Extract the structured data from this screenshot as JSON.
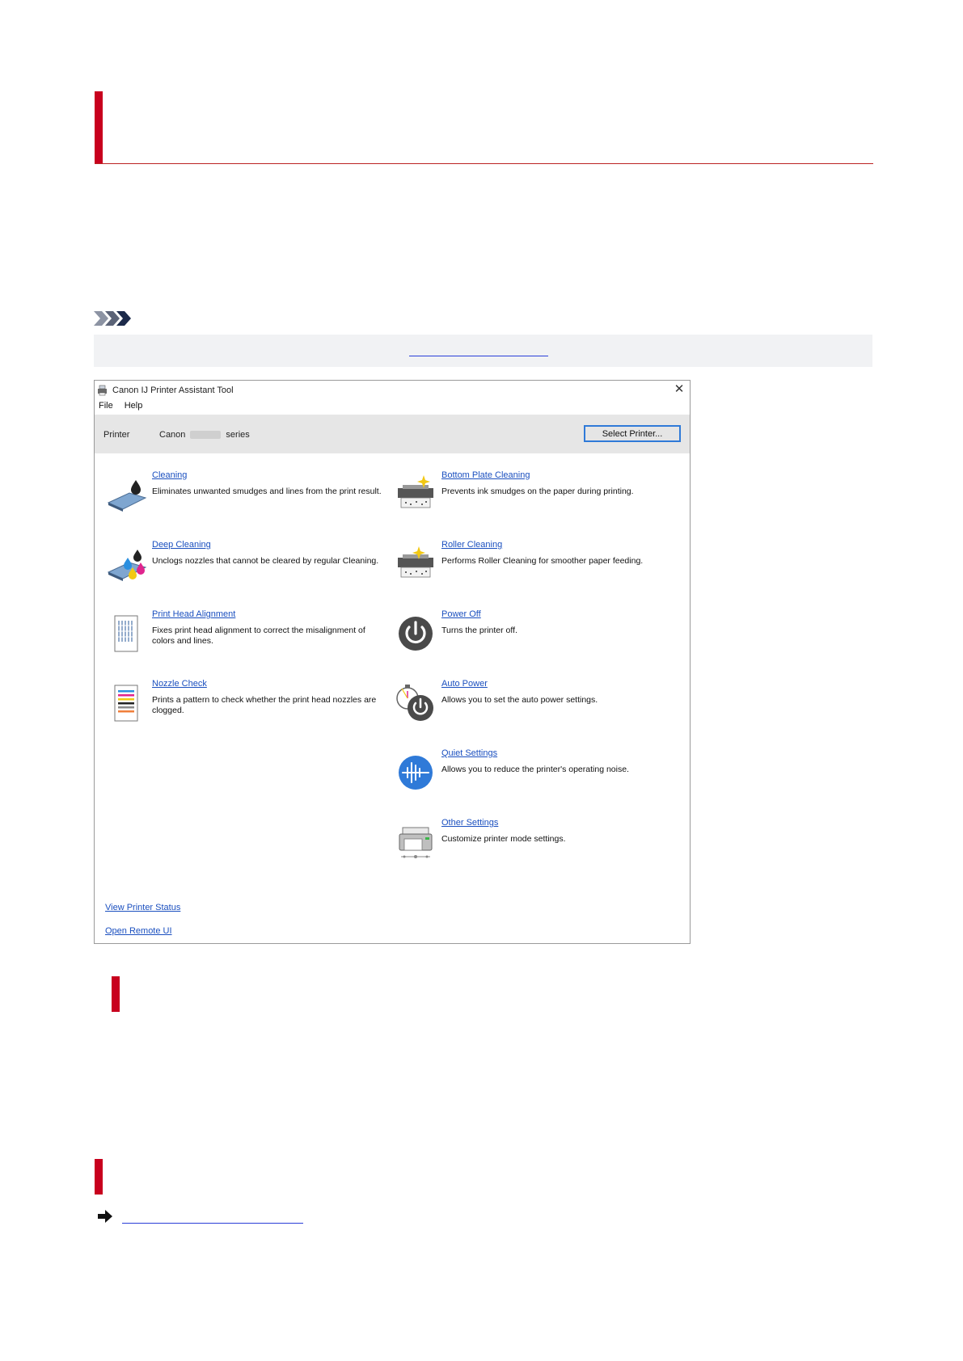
{
  "window": {
    "title": "Canon IJ Printer Assistant Tool",
    "close_glyph": "✕",
    "menu": [
      "File",
      "Help"
    ]
  },
  "printer_bar": {
    "label": "Printer",
    "brand": "Canon",
    "suffix": "series",
    "select_button": "Select Printer..."
  },
  "left_items": [
    {
      "link": "Cleaning",
      "desc": "Eliminates unwanted smudges and lines from the print result.",
      "icon": "cleaning-icon"
    },
    {
      "link": "Deep Cleaning",
      "desc": "Unclogs nozzles that cannot be cleared by regular Cleaning.",
      "icon": "deep-cleaning-icon"
    },
    {
      "link": "Print Head Alignment",
      "desc": "Fixes print head alignment to correct the misalignment of colors and lines.",
      "icon": "print-head-alignment-icon"
    },
    {
      "link": "Nozzle Check",
      "desc": "Prints a pattern to check whether the print head nozzles are clogged.",
      "icon": "nozzle-check-icon"
    }
  ],
  "right_items": [
    {
      "link": "Bottom Plate Cleaning",
      "desc": "Prevents ink smudges on the paper during printing.",
      "icon": "bottom-plate-cleaning-icon"
    },
    {
      "link": "Roller Cleaning",
      "desc": "Performs Roller Cleaning for smoother paper feeding.",
      "icon": "roller-cleaning-icon"
    },
    {
      "link": "Power Off",
      "desc": "Turns the printer off.",
      "icon": "power-icon"
    },
    {
      "link": "Auto Power",
      "desc": "Allows you to set the auto power settings.",
      "icon": "auto-power-icon"
    },
    {
      "link": "Quiet Settings",
      "desc": "Allows you to reduce the printer's operating noise.",
      "icon": "quiet-settings-icon"
    },
    {
      "link": "Other Settings",
      "desc": "Customize printer mode settings.",
      "icon": "printer-settings-icon"
    }
  ],
  "footer": {
    "view_status": "View Printer Status",
    "remote_ui": "Open Remote UI"
  },
  "colors": {
    "accent_red": "#c8001e",
    "link_blue": "#1a4fbf",
    "button_border": "#2f7ad8"
  }
}
